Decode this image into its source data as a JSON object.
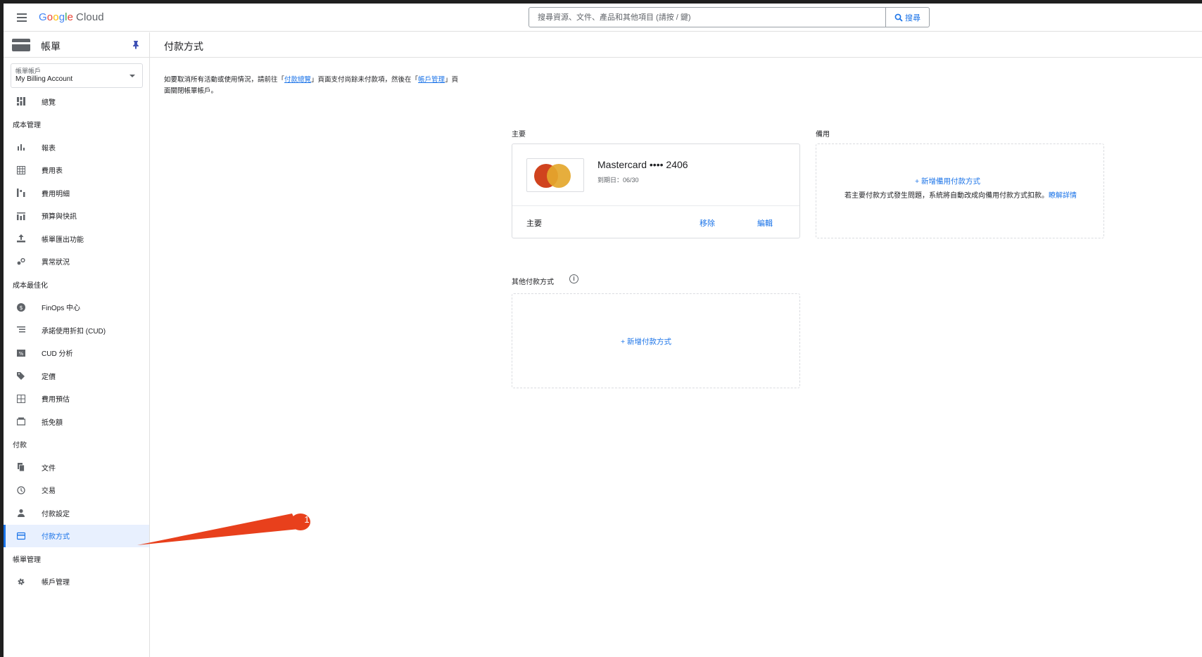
{
  "topbar": {
    "menu_icon": "hamburger-menu-icon",
    "logo": {
      "g": "G",
      "o1": "o",
      "o2": "o",
      "g2": "g",
      "l": "l",
      "e": "e",
      "cloud": "Cloud"
    },
    "search_placeholder": "搜尋資源、文件、產品和其他項目 (請按 / 鍵)",
    "search_button": "搜尋"
  },
  "sidebar": {
    "title": "帳單",
    "account_label": "帳單帳戶",
    "account_value": "My Billing Account",
    "items": [
      {
        "label": "總覽",
        "icon": "dashboard-icon"
      },
      {
        "section": "成本管理"
      },
      {
        "label": "報表",
        "icon": "bar-chart-icon"
      },
      {
        "label": "費用表",
        "icon": "table-icon"
      },
      {
        "label": "費用明細",
        "icon": "breakdown-icon"
      },
      {
        "label": "預算與快訊",
        "icon": "budget-icon"
      },
      {
        "label": "帳單匯出功能",
        "icon": "export-icon"
      },
      {
        "label": "異常狀況",
        "icon": "anomaly-icon"
      },
      {
        "section": "成本最佳化"
      },
      {
        "label": "FinOps 中心",
        "icon": "dollar-icon"
      },
      {
        "label": "承諾使用折扣 (CUD)",
        "icon": "list-icon"
      },
      {
        "label": "CUD 分析",
        "icon": "percent-icon"
      },
      {
        "label": "定價",
        "icon": "tag-icon"
      },
      {
        "label": "費用預估",
        "icon": "calculator-icon"
      },
      {
        "label": "抵免額",
        "icon": "credits-icon"
      },
      {
        "section": "付款"
      },
      {
        "label": "文件",
        "icon": "document-icon"
      },
      {
        "label": "交易",
        "icon": "clock-icon"
      },
      {
        "label": "付款設定",
        "icon": "person-icon"
      },
      {
        "label": "付款方式",
        "icon": "credit-card-icon",
        "active": true
      },
      {
        "section": "帳單管理"
      },
      {
        "label": "帳戶管理",
        "icon": "gear-icon"
      }
    ]
  },
  "main": {
    "page_title": "付款方式",
    "notice_1": "如要取消所有活動或使用情況，請前往「",
    "notice_link_1": "付款總覽",
    "notice_2": "」頁面支付尚餘未付款項，然後在「",
    "notice_link_2": "帳戶管理",
    "notice_3": "」頁面關閉帳單帳戶。",
    "primary_label": "主要",
    "backup_label": "備用",
    "card": {
      "name": "Mastercard •••• 2406",
      "expiry": "到期日：06/30",
      "role": "主要",
      "remove": "移除",
      "edit": "編輯"
    },
    "backup": {
      "add_link": "+ 新增備用付款方式",
      "desc": "若主要付款方式發生問題，系統將自動改成向備用付款方式扣款。",
      "learn_more": "瞭解詳情"
    },
    "other_label": "其他付款方式",
    "other_add_link": "+ 新增付款方式"
  },
  "annotation": {
    "number": "1",
    "color": "#e8401c"
  }
}
